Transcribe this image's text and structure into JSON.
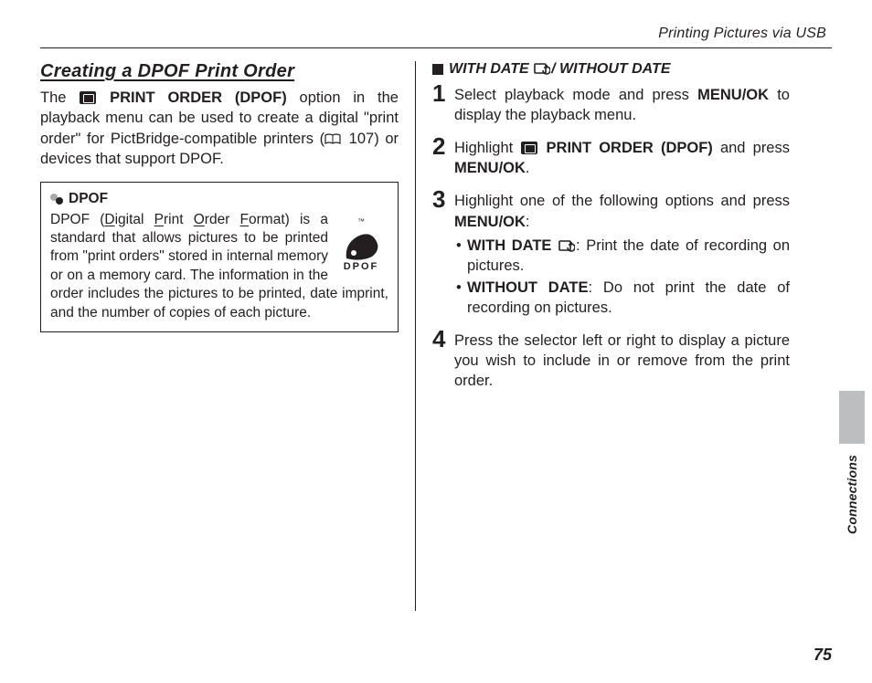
{
  "header": {
    "title": "Printing Pictures via USB"
  },
  "main": {
    "heading": "Creating a DPOF Print Order",
    "intro_a": "The ",
    "intro_b": " PRINT ORDER (DPOF)",
    "intro_c": " option in the playback menu can be used to create a digital \"print order\" for PictBridge-compatible printers (",
    "intro_d": " 107) or devices that support DPOF.",
    "infobox": {
      "title": "DPOF",
      "body_a": "DPOF (",
      "body_b": "D",
      "body_c": "igital ",
      "body_d": "P",
      "body_e": "rint ",
      "body_f": "O",
      "body_g": "rder ",
      "body_h": "F",
      "body_i": "ormat) is a standard that allows pictures to be printed from \"print orders\" stored in internal memory or on a memory card.  The information in the order includes the pictures to be printed, date imprint, and the number of copies of each picture.",
      "logo_word": "DPOF",
      "tm": "™"
    }
  },
  "right": {
    "subheading_a": "WITH DATE ",
    "subheading_b": "/ WITHOUT DATE",
    "steps": [
      {
        "a": "Select playback mode and press ",
        "b": "MENU/OK",
        "c": " to display the playback menu."
      },
      {
        "a": "Highlight ",
        "b": " PRINT ORDER (DPOF)",
        "c": " and press ",
        "d": "MENU/OK",
        "e": "."
      },
      {
        "a": "Highlight one of the following options and press ",
        "b": "MENU/OK",
        "c": ":",
        "opts": [
          {
            "t": "WITH DATE ",
            "r": ": Print the date of recording on pictures."
          },
          {
            "t": "WITHOUT DATE",
            "r": ": Do not print the date of recording on pictures."
          }
        ]
      },
      {
        "a": "Press the selector left or right to display a picture you wish to include in or remove from the print order."
      }
    ]
  },
  "side": {
    "label": "Connections"
  },
  "pagenum": "75"
}
